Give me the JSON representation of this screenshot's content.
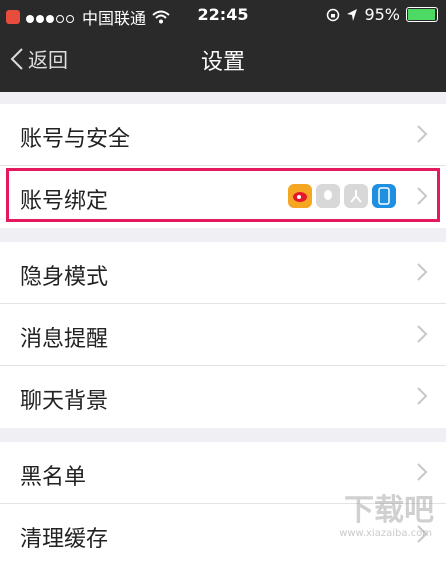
{
  "status_bar": {
    "carrier": "中国联通",
    "time": "22:45",
    "battery": "95%",
    "battery_level": 0.95
  },
  "nav": {
    "back_label": "返回",
    "title": "设置"
  },
  "groups": [
    {
      "items": [
        {
          "label": "账号与安全"
        },
        {
          "label": "账号绑定"
        }
      ]
    },
    {
      "items": [
        {
          "label": "隐身模式"
        },
        {
          "label": "消息提醒"
        },
        {
          "label": "聊天背景"
        }
      ]
    },
    {
      "items": [
        {
          "label": "黑名单"
        },
        {
          "label": "清理缓存"
        }
      ]
    }
  ],
  "binding_icons": [
    "weibo-icon",
    "qq-icon",
    "renren-icon",
    "phone-icon"
  ],
  "colors": {
    "bar_bg": "#2a2a2a",
    "highlight": "#e5195f",
    "page_bg": "#f0eff4"
  },
  "watermark": {
    "text": "下载吧",
    "sub": "www.xiazaiba.com"
  }
}
